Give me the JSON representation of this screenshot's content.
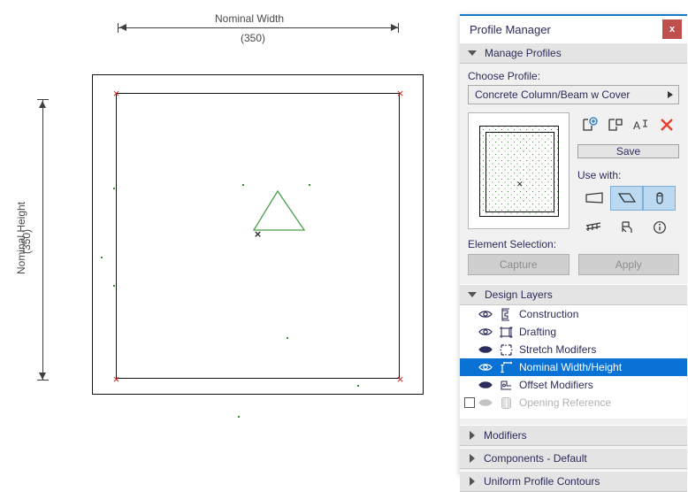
{
  "canvas": {
    "width_dimension": {
      "label": "Nominal Width",
      "value": "(350)"
    },
    "height_dimension": {
      "label": "Nominal Height",
      "value": "(350)"
    },
    "corner_marker": "×",
    "origin_marker": "×",
    "colors": {
      "profile_line": "#111111",
      "corner_marker": "#cc2222",
      "shape_green": "#4a9e4a",
      "dimension": "#3f3f3f"
    }
  },
  "panel": {
    "title": "Profile Manager",
    "close_label": "x",
    "accent_color": "#1879c8",
    "sections": {
      "manage_profiles": {
        "label": "Manage Profiles",
        "expanded": true
      },
      "design_layers": {
        "label": "Design Layers",
        "expanded": true
      },
      "modifiers": {
        "label": "Modifiers",
        "expanded": false
      },
      "components_default": {
        "label": "Components - Default",
        "expanded": false
      },
      "uniform_profile_contours": {
        "label": "Uniform Profile Contours",
        "expanded": false
      }
    },
    "choose_profile": {
      "label": "Choose Profile:",
      "value": "Concrete Column/Beam w Cover"
    },
    "profile_tools": [
      {
        "name": "new-profile-icon",
        "title": "New Profile"
      },
      {
        "name": "duplicate-profile-icon",
        "title": "Duplicate Profile"
      },
      {
        "name": "rename-profile-icon",
        "title": "Rename Profile"
      },
      {
        "name": "delete-profile-icon",
        "title": "Delete Profile"
      }
    ],
    "save_label": "Save",
    "use_with": {
      "label": "Use with:",
      "options": [
        {
          "name": "wall-icon",
          "label": "Wall",
          "selected": false
        },
        {
          "name": "beam-icon",
          "label": "Beam",
          "selected": true
        },
        {
          "name": "column-icon",
          "label": "Column",
          "selected": true
        },
        {
          "name": "railing-icon",
          "label": "Railing",
          "selected": false
        },
        {
          "name": "object-icon",
          "label": "Object",
          "selected": false
        },
        {
          "name": "info-icon",
          "label": "Info",
          "selected": false
        }
      ]
    },
    "element_selection": {
      "label": "Element Selection:",
      "capture_label": "Capture",
      "apply_label": "Apply"
    },
    "design_layers_list": [
      {
        "label": "Construction",
        "icon": "construction-layer-icon",
        "visible": true,
        "selected": false,
        "enabled": true,
        "has_checkbox": false
      },
      {
        "label": "Drafting",
        "icon": "drafting-layer-icon",
        "visible": true,
        "selected": false,
        "enabled": true,
        "has_checkbox": false
      },
      {
        "label": "Stretch Modifers",
        "icon": "stretch-modifiers-layer-icon",
        "visible": false,
        "selected": false,
        "enabled": true,
        "has_checkbox": false
      },
      {
        "label": "Nominal Width/Height",
        "icon": "nominal-dimensions-layer-icon",
        "visible": true,
        "selected": true,
        "enabled": true,
        "has_checkbox": false
      },
      {
        "label": "Offset Modifiers",
        "icon": "offset-modifiers-layer-icon",
        "visible": false,
        "selected": false,
        "enabled": true,
        "has_checkbox": false
      },
      {
        "label": "Opening Reference",
        "icon": "opening-reference-layer-icon",
        "visible": false,
        "selected": false,
        "enabled": false,
        "has_checkbox": true
      }
    ]
  }
}
